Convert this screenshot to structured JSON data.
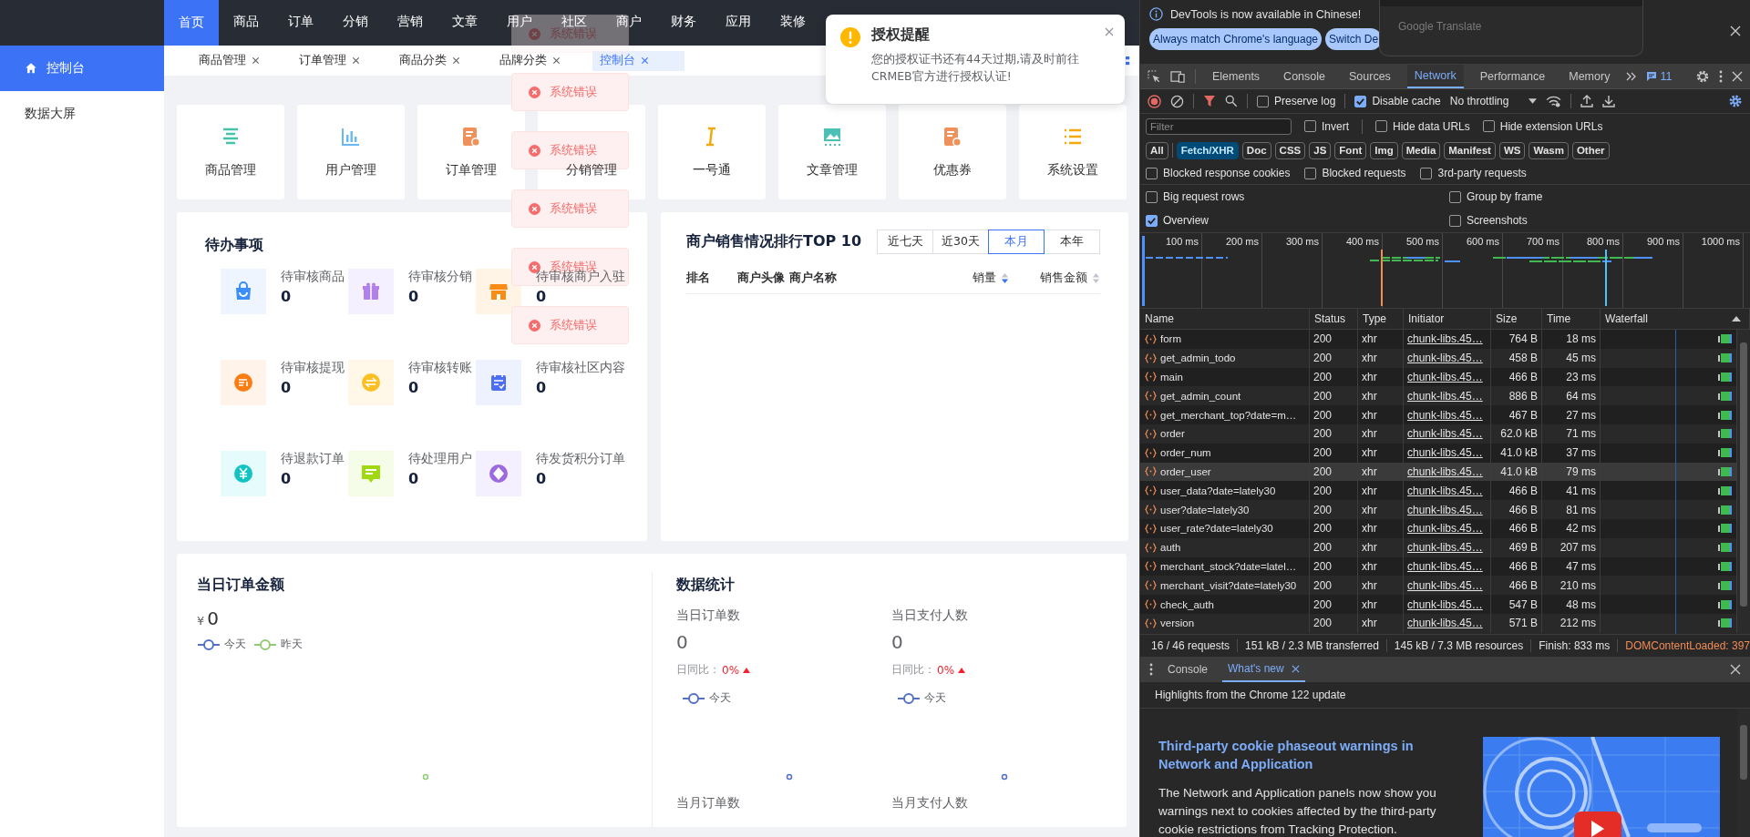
{
  "top_nav": [
    {
      "label": "首页",
      "selected": true
    },
    {
      "label": "商品",
      "selected": false
    },
    {
      "label": "订单",
      "selected": false
    },
    {
      "label": "分销",
      "selected": false
    },
    {
      "label": "营销",
      "selected": false
    },
    {
      "label": "文章",
      "selected": false
    },
    {
      "label": "用户",
      "selected": false
    },
    {
      "label": "社区",
      "selected": false
    },
    {
      "label": "商户",
      "selected": false
    },
    {
      "label": "财务",
      "selected": false
    },
    {
      "label": "应用",
      "selected": false
    },
    {
      "label": "装修",
      "selected": false
    }
  ],
  "sidebar": [
    {
      "label": "控制台",
      "selected": true
    },
    {
      "label": "数据大屏",
      "selected": false
    }
  ],
  "tabs": [
    {
      "label": "商品管理",
      "selected": false
    },
    {
      "label": "订单管理",
      "selected": false
    },
    {
      "label": "商品分类",
      "selected": false
    },
    {
      "label": "品牌分类",
      "selected": false
    },
    {
      "label": "控制台",
      "selected": true
    }
  ],
  "quick_entries": [
    "商品管理",
    "用户管理",
    "订单管理",
    "分销管理",
    "一号通",
    "文章管理",
    "优惠券",
    "系统设置"
  ],
  "error_toasts": [
    "系统错误",
    "系统错误",
    "系统错误",
    "系统错误",
    "系统错误",
    "系统错误"
  ],
  "notice": {
    "title": "授权提醒",
    "message": "您的授权证书还有44天过期,请及时前往CRMEB官方进行授权认证!"
  },
  "todo": {
    "title": "待办事项",
    "items": [
      {
        "label": "待审核商品",
        "count": "0"
      },
      {
        "label": "待审核分销",
        "count": "0"
      },
      {
        "label": "待审核商户入驻",
        "count": "0"
      },
      {
        "label": "待审核提现",
        "count": "0"
      },
      {
        "label": "待审核转账",
        "count": "0"
      },
      {
        "label": "待审核社区内容",
        "count": "0"
      },
      {
        "label": "待退款订单",
        "count": "0"
      },
      {
        "label": "待处理用户",
        "count": "0"
      },
      {
        "label": "待发货积分订单",
        "count": "0"
      }
    ]
  },
  "ranking": {
    "title": "商户销售情况排行TOP 10",
    "periods": [
      {
        "label": "近七天",
        "selected": false
      },
      {
        "label": "近30天",
        "selected": false
      },
      {
        "label": "本月",
        "selected": true
      },
      {
        "label": "本年",
        "selected": false
      }
    ],
    "columns": [
      {
        "label": "排名",
        "sortable": false
      },
      {
        "label": "商户头像",
        "sortable": false
      },
      {
        "label": "商户名称",
        "sortable": false
      },
      {
        "label": "销量",
        "sortable": true,
        "sorted_desc": true
      },
      {
        "label": "销售金额",
        "sortable": true,
        "sorted_desc": false
      }
    ]
  },
  "order_amount": {
    "title": "当日订单金额",
    "currency": "¥",
    "value": "0",
    "legend": [
      {
        "label": "今天",
        "color": "#5470c6"
      },
      {
        "label": "昨天",
        "color": "#91cc75"
      }
    ]
  },
  "stats": {
    "title": "数据统计",
    "daily": [
      {
        "label": "当日订单数",
        "value": "0",
        "compare_label": "日同比：",
        "compare_value": "0%",
        "legend": "今天"
      },
      {
        "label": "当日支付人数",
        "value": "0",
        "compare_label": "日同比：",
        "compare_value": "0%",
        "legend": "今天"
      }
    ],
    "monthly": [
      "当月订单数",
      "当月支付人数"
    ]
  },
  "devtools": {
    "infobar": {
      "message": "DevTools is now available in Chinese!",
      "buttons": [
        "Always match Chrome's language",
        "Switch De"
      ],
      "popup": "Google Translate"
    },
    "panels": [
      {
        "label": "Elements",
        "selected": false
      },
      {
        "label": "Console",
        "selected": false
      },
      {
        "label": "Sources",
        "selected": false
      },
      {
        "label": "Network",
        "selected": true
      },
      {
        "label": "Performance",
        "selected": false
      },
      {
        "label": "Memory",
        "selected": false
      }
    ],
    "issues_count": "11",
    "preserve_log": {
      "label": "Preserve log",
      "checked": false
    },
    "disable_cache": {
      "label": "Disable cache",
      "checked": true
    },
    "throttling": "No throttling",
    "filter": {
      "placeholder": "Filter"
    },
    "filter_options": [
      {
        "label": "Invert",
        "checked": false
      },
      {
        "label": "Hide data URLs",
        "checked": false
      },
      {
        "label": "Hide extension URLs",
        "checked": false
      }
    ],
    "types": [
      {
        "label": "All",
        "selected": false
      },
      {
        "label": "Fetch/XHR",
        "selected": true
      },
      {
        "label": "Doc",
        "selected": false
      },
      {
        "label": "CSS",
        "selected": false
      },
      {
        "label": "JS",
        "selected": false
      },
      {
        "label": "Font",
        "selected": false
      },
      {
        "label": "Img",
        "selected": false
      },
      {
        "label": "Media",
        "selected": false
      },
      {
        "label": "Manifest",
        "selected": false
      },
      {
        "label": "WS",
        "selected": false
      },
      {
        "label": "Wasm",
        "selected": false
      },
      {
        "label": "Other",
        "selected": false
      }
    ],
    "blocked_options": [
      {
        "label": "Blocked response cookies",
        "checked": false
      },
      {
        "label": "Blocked requests",
        "checked": false
      },
      {
        "label": "3rd-party requests",
        "checked": false
      }
    ],
    "settings": [
      {
        "label": "Big request rows",
        "checked": false
      },
      {
        "label": "Group by frame",
        "checked": false
      },
      {
        "label": "Overview",
        "checked": true
      },
      {
        "label": "Screenshots",
        "checked": false
      }
    ],
    "overview_ticks": [
      "100 ms",
      "200 ms",
      "300 ms",
      "400 ms",
      "500 ms",
      "600 ms",
      "700 ms",
      "800 ms",
      "900 ms",
      "1000 ms"
    ],
    "columns": [
      "Name",
      "Status",
      "Type",
      "Initiator",
      "Size",
      "Time",
      "Waterfall"
    ],
    "requests": [
      {
        "name": "form",
        "status": "200",
        "type": "xhr",
        "initiator": "chunk-libs.45…",
        "size": "764 B",
        "time": "18 ms",
        "selected": false
      },
      {
        "name": "get_admin_todo",
        "status": "200",
        "type": "xhr",
        "initiator": "chunk-libs.45…",
        "size": "458 B",
        "time": "45 ms",
        "selected": false
      },
      {
        "name": "main",
        "status": "200",
        "type": "xhr",
        "initiator": "chunk-libs.45…",
        "size": "466 B",
        "time": "23 ms",
        "selected": false
      },
      {
        "name": "get_admin_count",
        "status": "200",
        "type": "xhr",
        "initiator": "chunk-libs.45…",
        "size": "886 B",
        "time": "64 ms",
        "selected": false
      },
      {
        "name": "get_merchant_top?date=m…",
        "status": "200",
        "type": "xhr",
        "initiator": "chunk-libs.45…",
        "size": "467 B",
        "time": "27 ms",
        "selected": false
      },
      {
        "name": "order",
        "status": "200",
        "type": "xhr",
        "initiator": "chunk-libs.45…",
        "size": "62.0 kB",
        "time": "71 ms",
        "selected": false
      },
      {
        "name": "order_num",
        "status": "200",
        "type": "xhr",
        "initiator": "chunk-libs.45…",
        "size": "41.0 kB",
        "time": "37 ms",
        "selected": false
      },
      {
        "name": "order_user",
        "status": "200",
        "type": "xhr",
        "initiator": "chunk-libs.45…",
        "size": "41.0 kB",
        "time": "79 ms",
        "selected": true
      },
      {
        "name": "user_data?date=lately30",
        "status": "200",
        "type": "xhr",
        "initiator": "chunk-libs.45…",
        "size": "466 B",
        "time": "41 ms",
        "selected": false
      },
      {
        "name": "user?date=lately30",
        "status": "200",
        "type": "xhr",
        "initiator": "chunk-libs.45…",
        "size": "466 B",
        "time": "81 ms",
        "selected": false
      },
      {
        "name": "user_rate?date=lately30",
        "status": "200",
        "type": "xhr",
        "initiator": "chunk-libs.45…",
        "size": "466 B",
        "time": "42 ms",
        "selected": false
      },
      {
        "name": "auth",
        "status": "200",
        "type": "xhr",
        "initiator": "chunk-libs.45…",
        "size": "469 B",
        "time": "207 ms",
        "selected": false
      },
      {
        "name": "merchant_stock?date=latel…",
        "status": "200",
        "type": "xhr",
        "initiator": "chunk-libs.45…",
        "size": "466 B",
        "time": "47 ms",
        "selected": false
      },
      {
        "name": "merchant_visit?date=lately30",
        "status": "200",
        "type": "xhr",
        "initiator": "chunk-libs.45…",
        "size": "466 B",
        "time": "210 ms",
        "selected": false
      },
      {
        "name": "check_auth",
        "status": "200",
        "type": "xhr",
        "initiator": "chunk-libs.45…",
        "size": "547 B",
        "time": "48 ms",
        "selected": false
      },
      {
        "name": "version",
        "status": "200",
        "type": "xhr",
        "initiator": "chunk-libs.45…",
        "size": "571 B",
        "time": "212 ms",
        "selected": false
      }
    ],
    "summary": [
      "16 / 46 requests",
      "151 kB / 2.3 MB transferred",
      "145 kB / 7.3 MB resources",
      "Finish: 833 ms"
    ],
    "dom_content_loaded": "DOMContentLoaded: 397",
    "drawer_tabs": [
      {
        "label": "Console",
        "selected": false,
        "closable": false
      },
      {
        "label": "What's new",
        "selected": true,
        "closable": true
      }
    ],
    "whats_new": {
      "header": "Highlights from the Chrome 122 update",
      "title": "Third-party cookie phaseout warnings in Network and Application",
      "body": "The Network and Application panels now show you warnings next to cookies affected by the third-party cookie restrictions from Tracking Protection."
    }
  }
}
